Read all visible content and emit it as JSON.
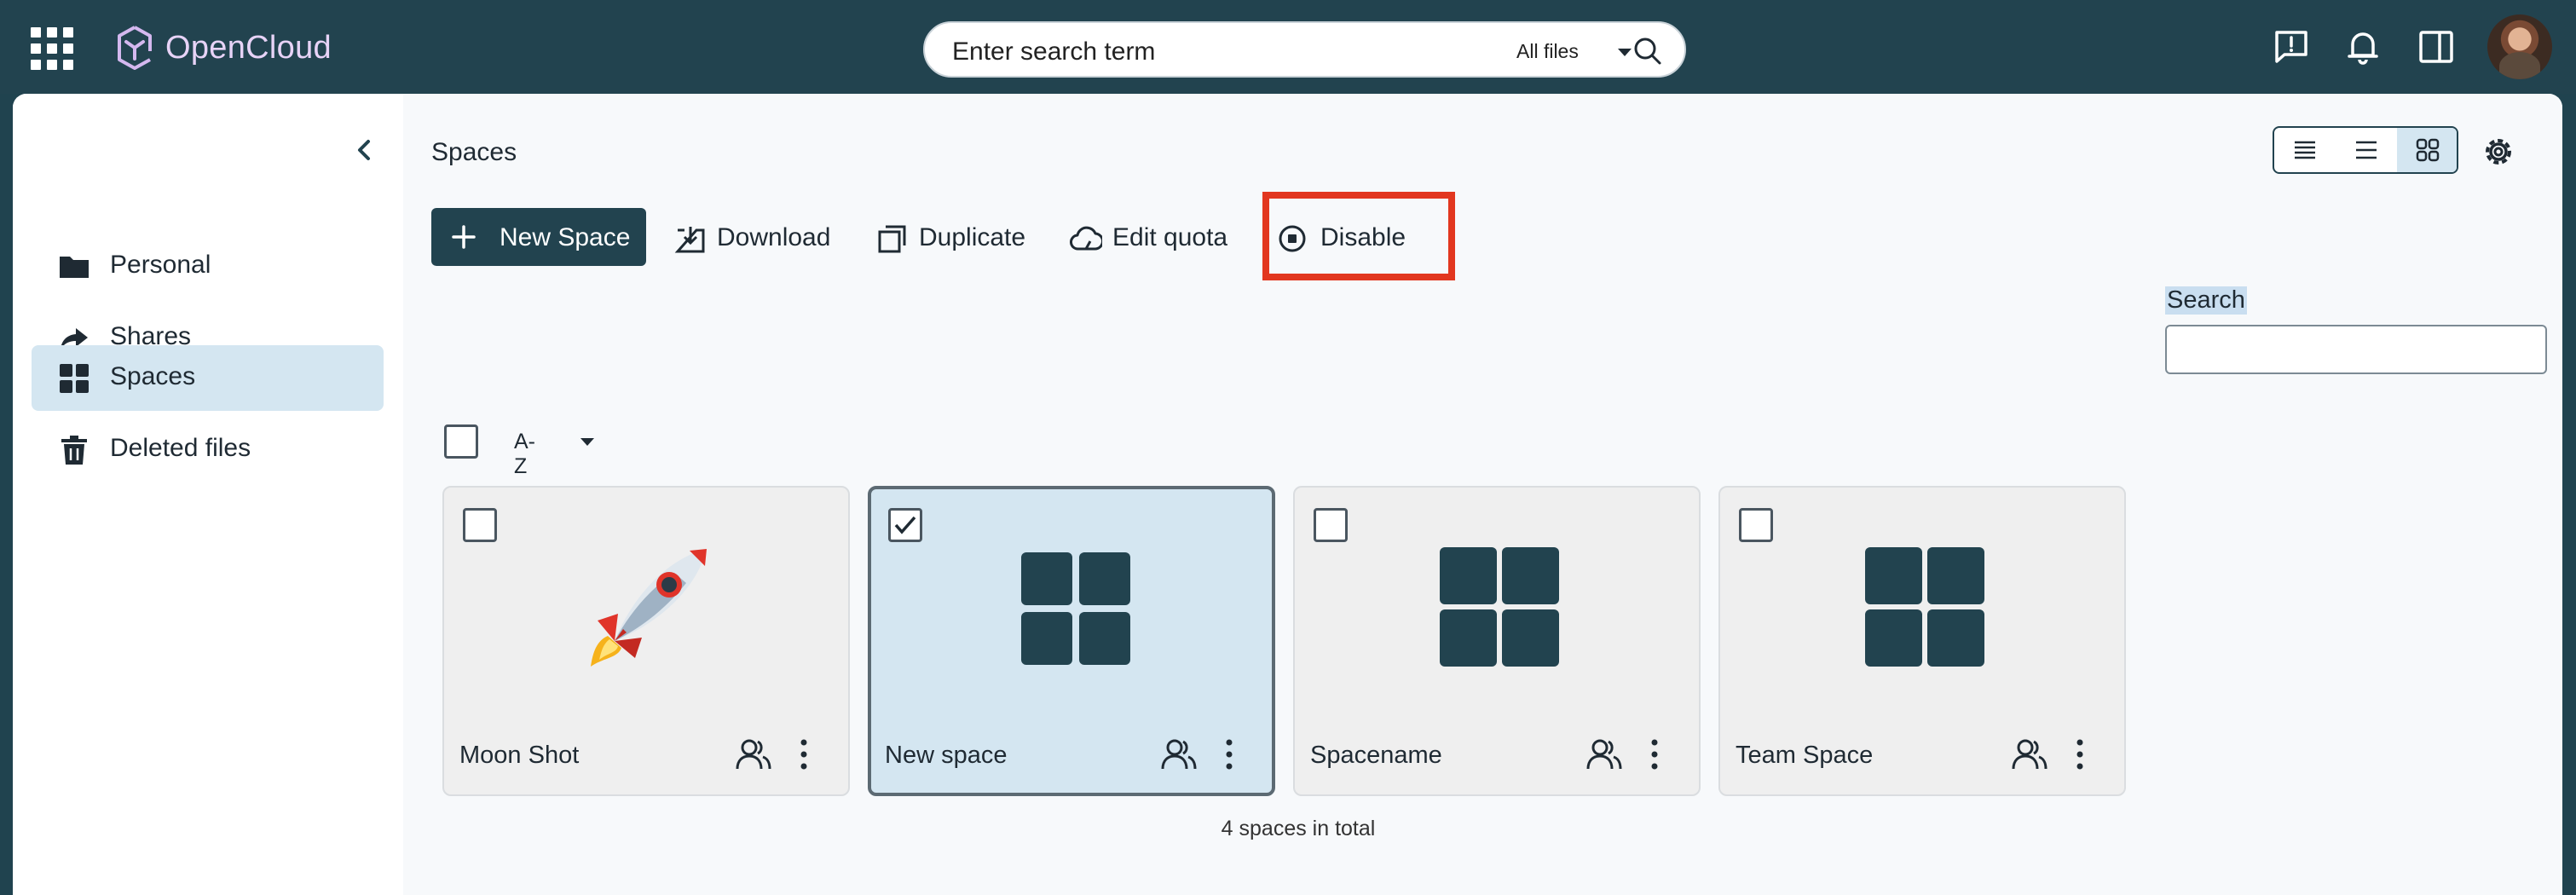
{
  "header": {
    "brand": "OpenCloud",
    "search_placeholder": "Enter search term",
    "search_scope": "All files"
  },
  "sidebar": {
    "items": [
      {
        "label": "Personal",
        "icon": "folder-icon",
        "active": false
      },
      {
        "label": "Shares",
        "icon": "share-arrow-icon",
        "active": false
      },
      {
        "label": "Spaces",
        "icon": "spaces-grid-icon",
        "active": true
      },
      {
        "label": "Deleted files",
        "icon": "trash-icon",
        "active": false
      }
    ]
  },
  "main": {
    "title": "Spaces",
    "toolbar": {
      "new_space": "New Space",
      "download": "Download",
      "duplicate": "Duplicate",
      "edit_quota": "Edit quota",
      "disable": "Disable"
    },
    "search_label": "Search",
    "sort_label": "A-Z",
    "spaces": [
      {
        "name": "Moon Shot",
        "checked": false,
        "thumb": "rocket"
      },
      {
        "name": "New space",
        "checked": true,
        "thumb": "grid"
      },
      {
        "name": "Spacename",
        "checked": false,
        "thumb": "grid"
      },
      {
        "name": "Team Space",
        "checked": false,
        "thumb": "grid"
      }
    ],
    "total": "4 spaces in total"
  },
  "colors": {
    "header_bg": "#22434f",
    "accent": "#22434f",
    "selected_bg": "#d4e6f1",
    "highlight": "#e2371f",
    "brand_text": "#e7d3f7"
  }
}
